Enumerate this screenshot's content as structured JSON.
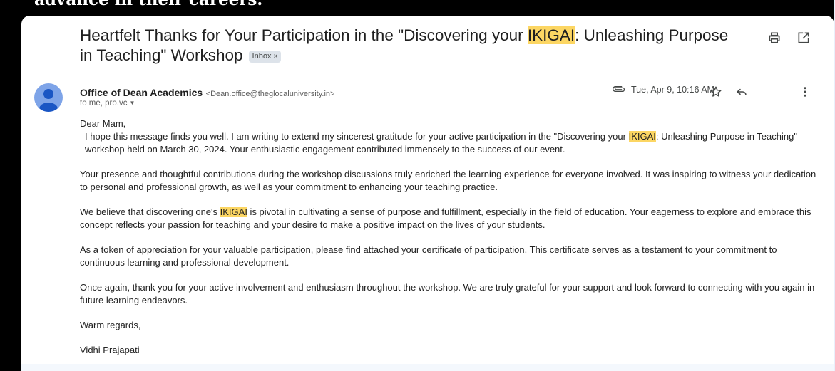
{
  "top_caption": "advance in their careers.",
  "email": {
    "subject_pre": "Heartfelt Thanks for Your Participation in the \"Discovering your ",
    "subject_hl": "IKIGAI",
    "subject_post": ": Unleashing Purpose in Teaching\" Workshop",
    "label_chip": "Inbox",
    "label_chip_close": "×",
    "sender_name": "Office of Dean Academics",
    "sender_email": "<Dean.office@theglocaluniversity.in>",
    "recipients": "to me, pro.vc",
    "date": "Tue, Apr 9, 10:16 AM",
    "greeting": "Dear Mam,",
    "p1_pre": "I hope this message finds you well. I am writing to extend my sincerest gratitude for your active participation in the \"Discovering your ",
    "p1_hl": "IKIGAI",
    "p1_post": ": Unleashing Purpose in Teaching\" workshop held on March 30, 2024. Your enthusiastic engagement contributed immensely to the success of our event.",
    "p2": "Your presence and thoughtful contributions during the workshop discussions truly enriched the learning experience for everyone involved. It was inspiring to witness your dedication to personal and professional growth, as well as your commitment to enhancing your teaching practice.",
    "p3_pre": "We believe that discovering one's ",
    "p3_hl": "IKIGAI",
    "p3_post": " is pivotal in cultivating a sense of purpose and fulfillment, especially in the field of education. Your eagerness to explore and embrace this concept reflects your passion for teaching and your desire to make a positive impact on the lives of your students.",
    "p4": "As a token of appreciation for your valuable participation, please find attached your certificate of participation. This certificate serves as a testament to your commitment to continuous learning and professional development.",
    "p5": "Once again, thank you for your active involvement and enthusiasm throughout the workshop. We are truly grateful for your support and look forward to connecting with you again in future learning endeavors.",
    "closing": "Warm regards,",
    "signature": "Vidhi Prajapati"
  },
  "icons": {
    "print": "print-icon",
    "popout": "open-in-new-window-icon",
    "attachment": "paperclip-icon",
    "star": "star-icon",
    "reply": "reply-icon",
    "more": "more-vert-icon",
    "avatar": "default-avatar-icon",
    "caret": "caret-down-icon"
  },
  "colors": {
    "highlight": "#fcd663",
    "avatar": "#7ea4e8",
    "chip_bg": "#dde3ea"
  }
}
